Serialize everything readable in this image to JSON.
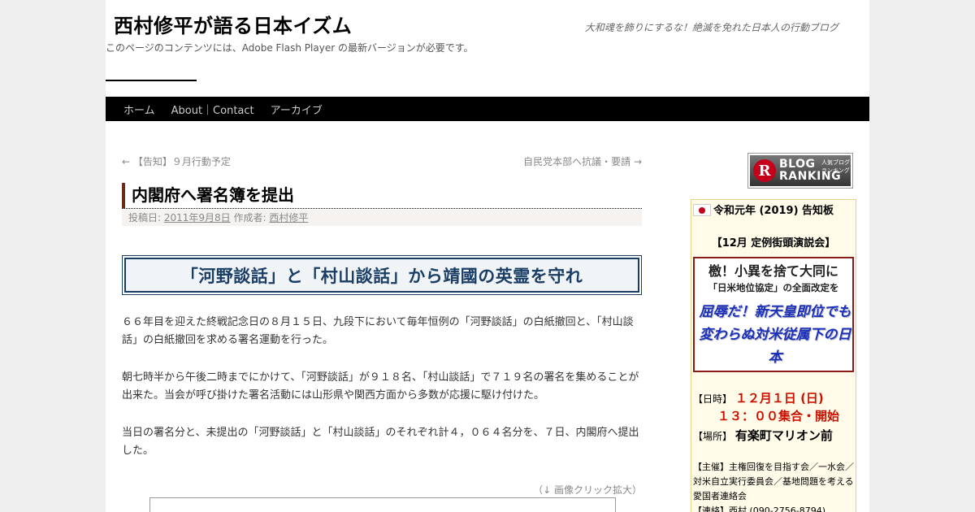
{
  "header": {
    "site_title": "西村修平が語る日本イズム",
    "site_description": "大和魂を飾りにするな！絶滅を免れた日本人の行動ブログ",
    "flash_note": "このページのコンテンツには、Adobe Flash Player の最新バージョンが必要です。"
  },
  "nav": {
    "items": [
      "ホーム",
      "About｜Contact",
      "アーカイブ"
    ]
  },
  "post_nav": {
    "prev": "← 【告知】９月行動予定",
    "next": "自民党本部へ抗議・要請 →"
  },
  "entry": {
    "title": "内閣府へ署名簿を提出",
    "meta_posted_label": "投稿日:",
    "meta_date": "2011年9月8日",
    "meta_author_label": "作成者:",
    "meta_author": "西村修平",
    "headline": "「河野談話」と「村山談話」から靖國の英霊を守れ",
    "paragraphs": [
      "６６年目を迎えた終戦記念日の８月１５日、九段下において毎年恒例の「河野談話」の白紙撤回と、「村山談話」の白紙撤回を求める署名運動を行った。",
      "朝七時半から午後二時までにかけて、「河野談話」が９１８名、「村山談話」で７１９名の署名を集めることが出来た。当会が呼び掛けた署名活動には山形県や関西方面から多数が応援に駆け付けた。",
      "当日の署名分と、未提出の「河野談話」と「村山談話」のそれぞれ計４，０６４名分を、７日、内閣府へ提出した。"
    ],
    "image_caption": "（↓ 画像クリック拡大）"
  },
  "sidebar": {
    "blog_ranking": {
      "line1": "BLOG",
      "line2": "RANKING",
      "small": "人気ブログランキング",
      "logo_letter": "R"
    },
    "notice": {
      "heading": "令和元年 (2019) 告知板",
      "event": "【12月 定例街頭演説会】",
      "poster_line1": "檄！小異を捨て大同に",
      "poster_line2": "「日米地位協定」の全面改定を",
      "poster_line3": "屈辱だ！新天皇即位でも変わらぬ対米従属下の日本",
      "date_label": "【日時】",
      "date_value": "１２月１日 (日)",
      "time_value": "１３：００集合・開始",
      "place_label": "【場所】",
      "place_value": "有楽町マリオン前",
      "organizer": "【主催】主権回復を目指す会／一水会／対米自立実行委員会／基地問題を考える愛国者連絡会",
      "contact": "【連絡】西村 (090-2756-8794)"
    }
  }
}
